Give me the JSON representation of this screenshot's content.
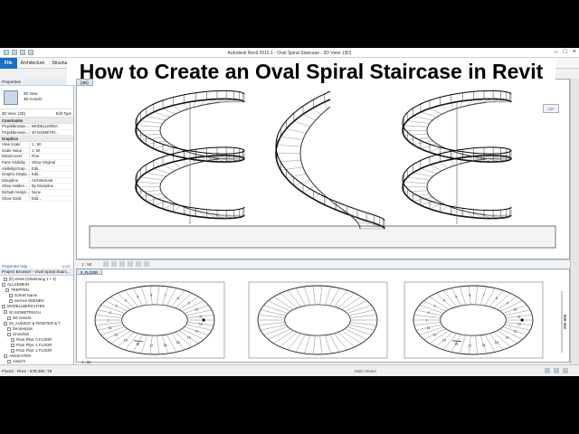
{
  "video_title": "How to Create an Oval Spiral Staircase in Revit",
  "window": {
    "title": "Autodesk Revit 2015.1 - Oval Spiral Staircase - 3D View: {3D}"
  },
  "ribbon": {
    "file_label": "File",
    "tabs": [
      "Architecture",
      "Structure"
    ]
  },
  "properties": {
    "header": "Properties",
    "type_line1": "3D View",
    "type_line2": "3D-Ansicht",
    "selector_value": "3D View: {3D}",
    "edit_type": "Edit Type",
    "groups": {
      "constraints": "Constraints",
      "graphics": "Graphics"
    },
    "constraints_rows": [
      {
        "k": "Projektbrowse...",
        "v": "MODELLERDA"
      },
      {
        "k": "Projektbrowse...",
        "v": "00 ISOMETRI..."
      }
    ],
    "graphics_rows": [
      {
        "k": "View Scale",
        "v": "1 : 50"
      },
      {
        "k": "Scale Value",
        "v": "1: 50"
      },
      {
        "k": "Detail Level",
        "v": "Fine"
      },
      {
        "k": "Parts Visibility",
        "v": "Show Original"
      },
      {
        "k": "Visibility/Grap...",
        "v": "Edit..."
      },
      {
        "k": "Graphic Displa...",
        "v": "Edit..."
      },
      {
        "k": "Discipline",
        "v": "Architectural"
      },
      {
        "k": "Show Hidden ...",
        "v": "By Discipline"
      },
      {
        "k": "Default Analys...",
        "v": "None"
      },
      {
        "k": "Show Grids",
        "v": "Edit..."
      }
    ],
    "help_link": "Properties help",
    "apply": "Apply"
  },
  "project_browser": {
    "header": "Project Browser - Oval Spiral Stairc...",
    "items": [
      "[0] Views (Gliederung 1 + 2)",
      "ALLGEMEIN",
      "TREPPEN",
      "Schnitt Name",
      "Sechen EBENEN",
      "MODELLBERICHTEN",
      "00 ISOMETRISCH",
      "3D-Ansicht",
      "02_AUSZUG & FENSTER & T",
      "Deckenplan",
      "Grundriss",
      "Floor Plan: 0 FLOOR",
      "Floor Plan: 1 FLOOR",
      "Floor Plan: 2 FLOOR",
      "ANSICHTEN",
      "Ansicht",
      "Elevation: Nord",
      "Elevation: Ost"
    ]
  },
  "views": {
    "view3d_tab": "{3D}",
    "view3d_scale": "1 : 50",
    "plan_tab": "0_FLOOR",
    "plan_scale": "1 : 50",
    "plan_dimension": "285.000"
  },
  "status": {
    "left": "Floors : Floor : 578.260 :78",
    "middle": "Main Model"
  },
  "plan_step_numbers": [
    "1",
    "2",
    "3",
    "4",
    "5",
    "6",
    "7",
    "8",
    "9",
    "10",
    "11",
    "12",
    "13",
    "14",
    "15",
    "16",
    "17",
    "18",
    "19",
    "20",
    "21"
  ]
}
